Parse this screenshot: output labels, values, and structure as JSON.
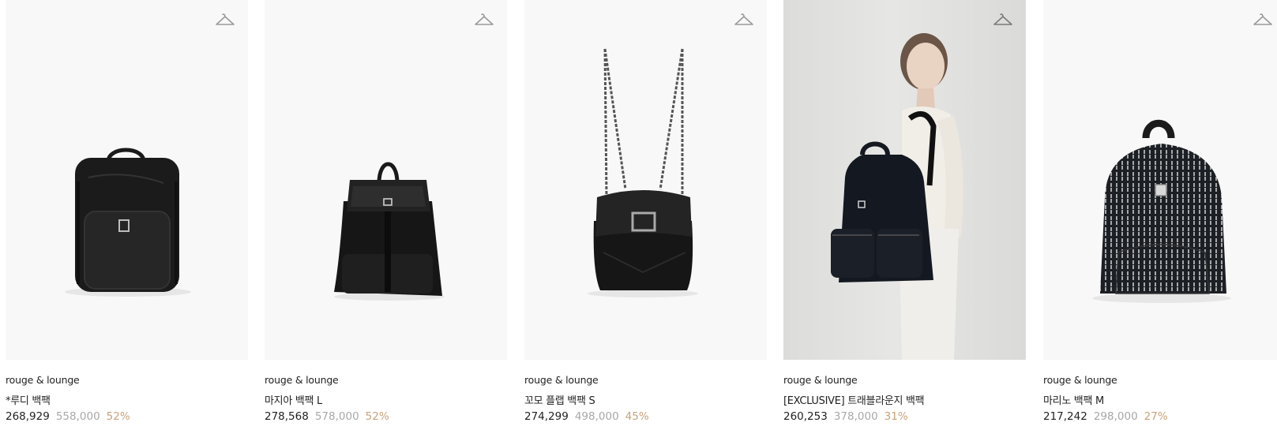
{
  "products": [
    {
      "brand": "rouge & lounge",
      "name": "*루디 백팩",
      "sale_price": "268,929",
      "original_price": "558,000",
      "discount": "52%",
      "image_icon": "backpack-leather-icon"
    },
    {
      "brand": "rouge & lounge",
      "name": "마지아 백팩 L",
      "sale_price": "278,568",
      "original_price": "578,000",
      "discount": "52%",
      "image_icon": "backpack-drawstring-icon"
    },
    {
      "brand": "rouge & lounge",
      "name": "꼬모 플랩 백팩 S",
      "sale_price": "274,299",
      "original_price": "498,000",
      "discount": "45%",
      "image_icon": "backpack-chain-icon"
    },
    {
      "brand": "rouge & lounge",
      "name": "[EXCLUSIVE] 트래블라운지 백팩",
      "sale_price": "260,253",
      "original_price": "378,000",
      "discount": "31%",
      "image_icon": "model-with-backpack-icon"
    },
    {
      "brand": "rouge & lounge",
      "name": "마리노 백팩 M",
      "sale_price": "217,242",
      "original_price": "298,000",
      "discount": "27%",
      "image_icon": "backpack-pattern-icon"
    }
  ],
  "colors": {
    "discount": "#c8a27a",
    "original_price": "#a8a8a8",
    "text": "#222222"
  }
}
